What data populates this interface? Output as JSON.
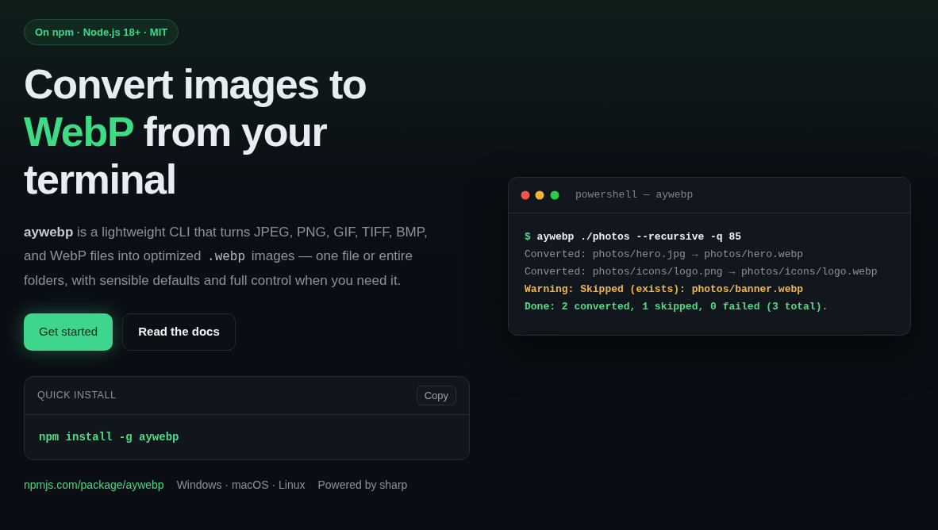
{
  "badge": "On npm · Node.js 18+ · MIT",
  "headline": [
    {
      "text": "Convert images to ",
      "accent": false
    },
    {
      "text": "WebP",
      "accent": true
    },
    {
      "text": " from your terminal",
      "accent": false
    }
  ],
  "description": [
    {
      "kind": "strong",
      "text": "aywebp"
    },
    {
      "kind": "plain",
      "text": " is a lightweight CLI that turns JPEG, PNG, GIF, TIFF, BMP, and WebP files into optimized "
    },
    {
      "kind": "code",
      "text": ".webp"
    },
    {
      "kind": "plain",
      "text": " images — one file or entire folders, with sensible defaults and full control when you need it."
    }
  ],
  "actions": [
    {
      "label": "Get started",
      "kind": "primary"
    },
    {
      "label": "Read the docs",
      "kind": "secondary"
    }
  ],
  "quick_install": {
    "title": "QUICK INSTALL",
    "copy_button": "Copy",
    "command": "npm install -g aywebp"
  },
  "footer_links": [
    {
      "text": "npmjs.com/package/aywebp",
      "kind": "link"
    },
    {
      "text": "Windows · macOS · Linux",
      "kind": "note"
    },
    {
      "text": "Powered by sharp",
      "kind": "note"
    }
  ],
  "terminal": {
    "title": "powershell — aywebp",
    "lines": [
      {
        "kind": "command",
        "prompt": "$",
        "text": "aywebp ./photos --recursive -q 85"
      },
      {
        "kind": "output",
        "text": "Converted: photos/hero.jpg → photos/hero.webp"
      },
      {
        "kind": "output",
        "text": "Converted: photos/icons/logo.png → photos/icons/logo.webp"
      },
      {
        "kind": "warning",
        "text": "Warning: Skipped (exists): photos/banner.webp"
      },
      {
        "kind": "success",
        "text": "Done: 2 converted, 1 skipped, 0 failed (3 total)."
      }
    ]
  }
}
